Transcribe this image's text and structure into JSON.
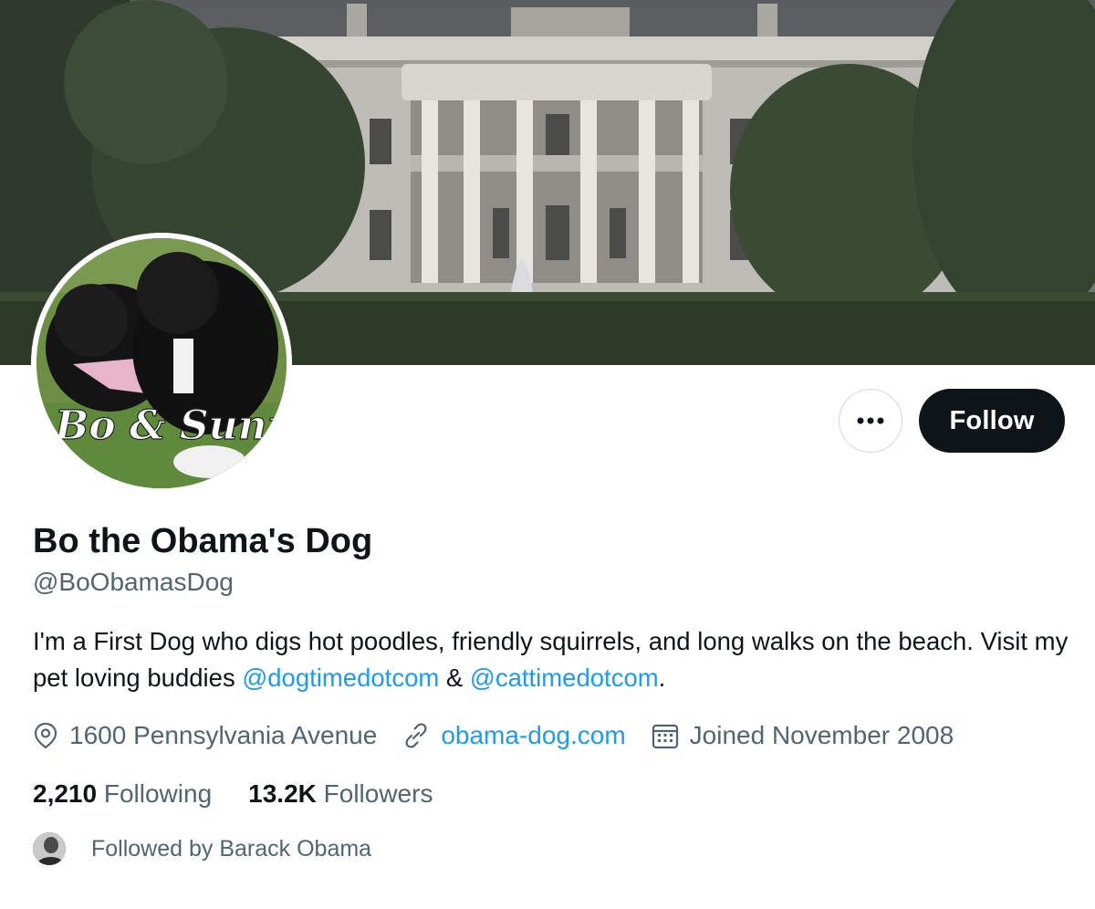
{
  "profile": {
    "display_name": "Bo the Obama's Dog",
    "handle": "@BoObamasDog",
    "avatar_text": "Bo & Sunny",
    "bio": {
      "text": "I'm a First Dog who digs hot poodles, friendly squirrels, and long walks on the beach. Visit my pet loving buddies ",
      "mention_1": "@dogtimedotcom",
      "connector": " & ",
      "mention_2": "@cattimedotcom",
      "end": "."
    },
    "location": "1600 Pennsylvania Avenue",
    "website": "obama-dog.com",
    "joined": "Joined November 2008"
  },
  "actions": {
    "follow_label": "Follow",
    "more_icon": "more-horizontal-icon"
  },
  "stats": {
    "following_count": "2,210",
    "following_label": "Following",
    "followers_count": "13.2K",
    "followers_label": "Followers"
  },
  "followed_by": {
    "text": "Followed by Barack Obama"
  },
  "icons": {
    "location": "location-pin-icon",
    "website": "link-icon",
    "joined": "calendar-icon"
  },
  "colors": {
    "text_primary": "#0f1419",
    "text_secondary": "#536471",
    "link": "#1d9bf0",
    "follow_button_bg": "#0f1419",
    "border": "#cfd9de"
  }
}
